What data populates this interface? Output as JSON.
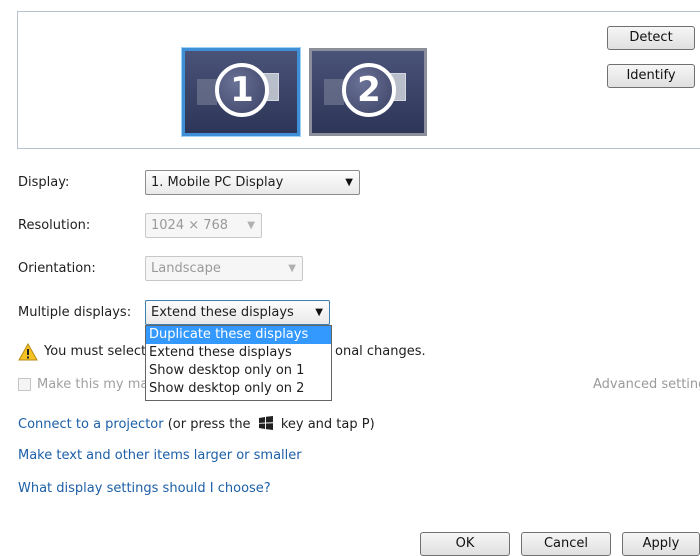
{
  "preview": {
    "monitors": [
      {
        "number": "1",
        "selected": true
      },
      {
        "number": "2",
        "selected": false
      }
    ],
    "detect_label": "Detect",
    "identify_label": "Identify"
  },
  "settings": {
    "display_label": "Display:",
    "display_value": "1. Mobile PC Display",
    "resolution_label": "Resolution:",
    "resolution_value": "1024 × 768",
    "orientation_label": "Orientation:",
    "orientation_value": "Landscape",
    "multiple_label": "Multiple displays:",
    "multiple_value": "Extend these displays"
  },
  "dropdown": {
    "options": [
      "Duplicate these displays",
      "Extend these displays",
      "Show desktop only on 1",
      "Show desktop only on 2"
    ],
    "highlighted_index": 0
  },
  "warning": {
    "text_left": "You must select",
    "text_right": "onal changes."
  },
  "make_main": {
    "label": "Make this my ma"
  },
  "advanced_link": "Advanced setting",
  "links": {
    "projector_link": "Connect to a projector",
    "projector_suffix_a": " (or press the ",
    "projector_suffix_b": " key and tap P)",
    "larger_link": "Make text and other items larger or smaller",
    "help_link": "What display settings should I choose?"
  },
  "footer": {
    "ok_label": "OK",
    "cancel_label": "Cancel",
    "apply_label": "Apply"
  },
  "colors": {
    "link": "#1d5fa8",
    "highlight": "#3399ff",
    "monitor_selected_border": "#3f8fd6"
  }
}
